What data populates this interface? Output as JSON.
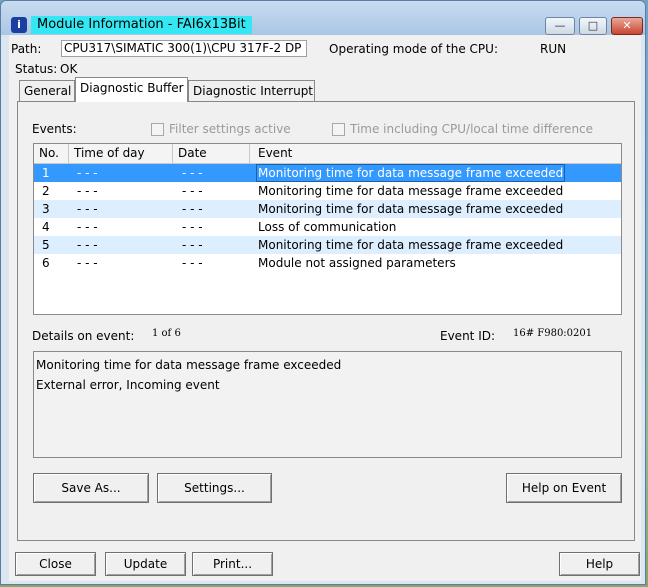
{
  "window": {
    "title": "Module Information - FAI6x13Bit",
    "app_icon": "i"
  },
  "header": {
    "path_label": "Path:",
    "path_value": "CPU317\\SIMATIC 300(1)\\CPU 317F-2 DP",
    "mode_label": "Operating mode of the  CPU:",
    "mode_value": "RUN",
    "status_label": "Status:",
    "status_value": "OK"
  },
  "tabs": [
    {
      "label": "General"
    },
    {
      "label": "Diagnostic Buffer",
      "active": true
    },
    {
      "label": "Diagnostic Interrupt"
    }
  ],
  "events": {
    "label": "Events:",
    "filter_label": "Filter settings active",
    "time_label": "Time including CPU/local time difference",
    "columns": [
      "No.",
      "Time of day",
      "Date",
      "Event"
    ],
    "rows": [
      {
        "no": "1",
        "time": "- - -",
        "date": "- - -",
        "event": "Monitoring time for data message frame exceeded"
      },
      {
        "no": "2",
        "time": "- - -",
        "date": "- - -",
        "event": "Monitoring time for data message frame exceeded"
      },
      {
        "no": "3",
        "time": "- - -",
        "date": "- - -",
        "event": "Monitoring time for data message frame exceeded"
      },
      {
        "no": "4",
        "time": "- - -",
        "date": "- - -",
        "event": "Loss of communication"
      },
      {
        "no": "5",
        "time": "- - -",
        "date": "- - -",
        "event": "Monitoring time for data message frame exceeded"
      },
      {
        "no": "6",
        "time": "- - -",
        "date": "- - -",
        "event": "Module not assigned parameters"
      }
    ]
  },
  "details": {
    "label": "Details on event:",
    "counter": "1  of  6",
    "event_id_label": "Event ID:",
    "event_id_value": "16# F980:0201",
    "line1": "Monitoring time for data message frame exceeded",
    "line2": "External error, Incoming event"
  },
  "buttons": {
    "save_as": "Save As...",
    "settings": "Settings...",
    "help_on_event": "Help on Event",
    "close": "Close",
    "update": "Update",
    "print": "Print...",
    "help": "Help"
  },
  "colors": {
    "title_highlight": "#35e7f2",
    "selection": "#3399ff",
    "alt_row": "#ddeeff"
  }
}
